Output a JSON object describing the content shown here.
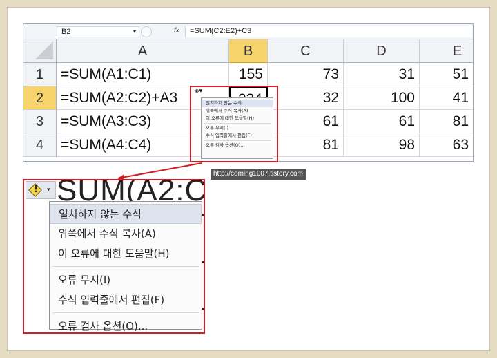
{
  "formula_bar": {
    "name_box": "B2",
    "fx_label": "fx",
    "formula": "=SUM(C2:E2)+C3"
  },
  "grid": {
    "columns": [
      "A",
      "B",
      "C",
      "D",
      "E"
    ],
    "selected_column": "B",
    "rows": [
      {
        "header": "1",
        "cells": [
          "=SUM(A1:C1)",
          "155",
          "73",
          "31",
          "51"
        ]
      },
      {
        "header": "2",
        "cells": [
          "=SUM(A2:C2)+A3",
          "234",
          "32",
          "100",
          "41"
        ]
      },
      {
        "header": "3",
        "cells": [
          "=SUM(A3:C3)",
          "",
          "61",
          "61",
          "81"
        ]
      },
      {
        "header": "4",
        "cells": [
          "=SUM(A4:C4)",
          "",
          "81",
          "98",
          "63"
        ]
      }
    ],
    "selected_row": "2"
  },
  "error_menu": {
    "warning_icon": "warning-diamond-icon",
    "items": [
      "일치하지 않는 수식",
      "위쪽에서 수식 복사(A)",
      "이 오류에 대한 도움말(H)",
      "오류 무시(I)",
      "수식 입력줄에서 편집(F)",
      "오류 검사 옵션(O)..."
    ]
  },
  "zoom": {
    "background_text": "SUM(A2:C",
    "items": [
      "일치하지 않는 수식",
      "위쪽에서 수식 복사(A)",
      "이 오류에 대한 도움말(H)",
      "오류 무시(I)",
      "수식 입력줄에서 편집(F)",
      "오류 검사 옵션(O)..."
    ]
  },
  "watermark": "http://coming1007.tistory.com",
  "colors": {
    "highlight_red": "#d11e24",
    "selected_header": "#f7d46b",
    "menu_highlight": "#dfe3ee"
  }
}
